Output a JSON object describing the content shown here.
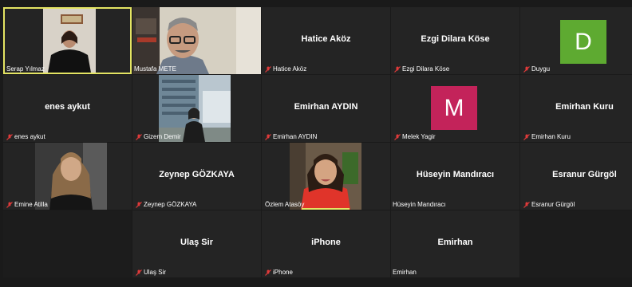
{
  "colors": {
    "background": "#1a1a1a",
    "tile": "#242424",
    "active_border": "#e4e463",
    "mute_icon": "#e03a3a",
    "avatar_duygu": "#5eaa31",
    "avatar_melek": "#c3235a"
  },
  "participants": {
    "serap": {
      "name": "Serap Yılmaz",
      "icon": "video-feed"
    },
    "mustafa": {
      "name": "Mustafa METE",
      "icon": "video-feed"
    },
    "hatice": {
      "display": "Hatice Aköz",
      "name": "Hatice Aköz",
      "muted": true
    },
    "ezgi": {
      "display": "Ezgi Dilara Köse",
      "name": "Ezgi Dilara Köse",
      "muted": true
    },
    "duygu": {
      "avatar_letter": "D",
      "name": "Duygu",
      "muted": true
    },
    "enes": {
      "display": "enes aykut",
      "name": "enes aykut",
      "muted": true
    },
    "gizem": {
      "name": "Gizem Demir",
      "muted": true
    },
    "emirhan_aydin": {
      "display": "Emirhan AYDIN",
      "name": "Emirhan AYDIN",
      "muted": true
    },
    "melek": {
      "avatar_letter": "M",
      "name": "Melek Yagir",
      "muted": true
    },
    "emirhan_kuru": {
      "display": "Emirhan Kuru",
      "name": "Emirhan Kuru",
      "muted": true
    },
    "emine": {
      "name": "Emine Atilla",
      "muted": true
    },
    "zeynep": {
      "display": "Zeynep GÖZKAYA",
      "name": "Zeynep GÖZKAYA",
      "muted": true
    },
    "ozlem": {
      "name": "Özlem Atasöy"
    },
    "huseyin": {
      "display": "Hüseyin Mandıracı",
      "name": "Hüseyin Mandıracı"
    },
    "esranur": {
      "display": "Esranur Gürgöl",
      "name": "Esranur Gürgöl",
      "muted": true
    },
    "ulas": {
      "display": "Ulaş Sir",
      "name": "Ulaş Sir",
      "muted": true
    },
    "iphone": {
      "display": "iPhone",
      "name": "iPhone",
      "muted": true
    },
    "emirhan": {
      "display": "Emirhan",
      "name": "Emirhan"
    }
  }
}
